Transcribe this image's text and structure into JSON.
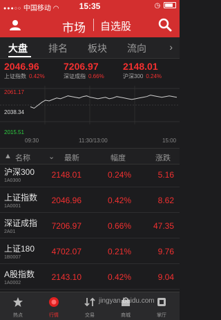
{
  "status_bar": {
    "carrier": "中国移动",
    "network": "WiFi",
    "time": "15:35"
  },
  "header": {
    "title": "市场",
    "subtitle": "自选股"
  },
  "tabs": [
    {
      "label": "大盘",
      "active": true
    },
    {
      "label": "排名",
      "active": false
    },
    {
      "label": "板块",
      "active": false
    },
    {
      "label": "流向",
      "active": false
    }
  ],
  "indices": [
    {
      "value": "2046.96",
      "name": "上证指数",
      "pct": "0.42%"
    },
    {
      "value": "7206.97",
      "name": "深证成指",
      "pct": "0.66%"
    },
    {
      "value": "2148.01",
      "name": "沪深300",
      "pct": "0.24%"
    }
  ],
  "chart_labels": {
    "high": "2061.17",
    "mid": "2038.34",
    "low": "2015.51",
    "t_start": "09:30",
    "t_mid": "11:30/13:00",
    "t_end": "15:00"
  },
  "chart_data": {
    "type": "line",
    "series": [
      {
        "values": [
          2036,
          2034,
          2038,
          2042,
          2045,
          2044,
          2046,
          2048,
          2047,
          2049,
          2051,
          2050,
          2049,
          2048,
          2050,
          2051,
          2049,
          2048,
          2047,
          2048,
          2049,
          2047,
          2048,
          2050,
          2049,
          2048,
          2047,
          2046,
          2047,
          2048,
          2049,
          2050,
          2052,
          2051,
          2050,
          2049,
          2050,
          2051,
          2050,
          2049
        ]
      }
    ],
    "ylim": [
      2015.51,
      2061.17
    ]
  },
  "table": {
    "headers": {
      "name": "名称",
      "price": "最新",
      "pct": "幅度",
      "change": "涨跌"
    },
    "rows": [
      {
        "name": "沪深300",
        "code": "1A0300",
        "price": "2148.01",
        "pct": "0.24%",
        "change": "5.16"
      },
      {
        "name": "上证指数",
        "code": "1A0001",
        "price": "2046.96",
        "pct": "0.42%",
        "change": "8.62"
      },
      {
        "name": "深证成指",
        "code": "2A01",
        "price": "7206.97",
        "pct": "0.66%",
        "change": "47.35"
      },
      {
        "name": "上证180",
        "code": "1B0007",
        "price": "4702.07",
        "pct": "0.21%",
        "change": "9.76"
      },
      {
        "name": "A股指数",
        "code": "1A0002",
        "price": "2143.10",
        "pct": "0.42%",
        "change": "9.04"
      }
    ]
  },
  "nav": [
    {
      "label": "热点",
      "icon": "star-icon",
      "active": false
    },
    {
      "label": "行情",
      "icon": "market-icon",
      "active": true
    },
    {
      "label": "交易",
      "icon": "trade-icon",
      "active": false
    },
    {
      "label": "商城",
      "icon": "mall-icon",
      "active": false
    },
    {
      "label": "掌厅",
      "icon": "hall-icon",
      "active": false
    }
  ],
  "watermark": "jingyan.baidu.com",
  "colors": {
    "brand": "#d32f2f",
    "up": "#f23030",
    "down": "#2ecc40",
    "line": "#cfcfcf"
  }
}
